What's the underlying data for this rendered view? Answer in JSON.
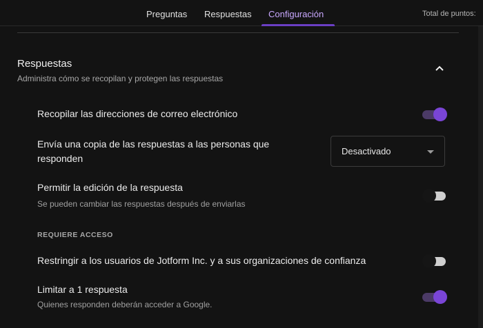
{
  "tabs": [
    {
      "label": "Preguntas"
    },
    {
      "label": "Respuestas"
    },
    {
      "label": "Configuración"
    }
  ],
  "total_points_label": "Total de puntos:",
  "section": {
    "title": "Respuestas",
    "subtitle": "Administra cómo se recopilan y protegen las respuestas"
  },
  "settings": {
    "collect_email": {
      "label": "Recopilar las direcciones de correo electrónico",
      "on": true
    },
    "send_copy": {
      "label_line1": "Envía una copia de las respuestas a las personas que",
      "label_line2": "responden",
      "value": "Desactivado"
    },
    "allow_edit": {
      "label": "Permitir la edición de la respuesta",
      "sub": "Se pueden cambiar las respuestas después de enviarlas",
      "on": false
    },
    "requires_access": "REQUIERE ACCESO",
    "restrict": {
      "label": "Restringir a los usuarios de Jotform Inc. y a sus organizaciones de confianza",
      "on": false
    },
    "limit_one": {
      "label": "Limitar a 1 respuesta",
      "sub": "Quienes responden deberán acceder a Google.",
      "on": true
    }
  },
  "colors": {
    "accent": "#7a45d6",
    "background": "#131313"
  }
}
